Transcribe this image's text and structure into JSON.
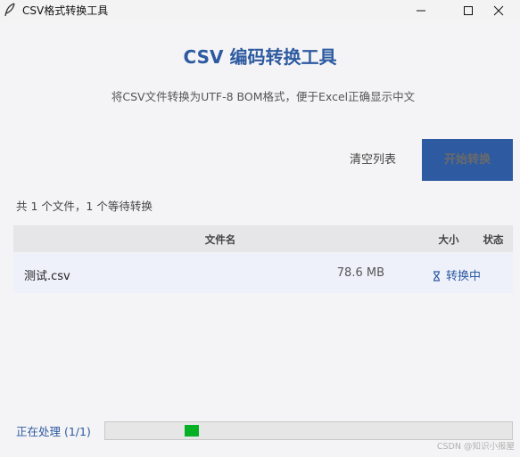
{
  "window": {
    "title": "CSV格式转换工具",
    "icon": "feather-icon"
  },
  "header": {
    "title": "CSV 编码转换工具",
    "subtitle": "将CSV文件转换为UTF-8 BOM格式，便于Excel正确显示中文"
  },
  "toolbar": {
    "clear_label": "清空列表",
    "start_label": "开始转换"
  },
  "summary": "共 1 个文件，1 个等待转换",
  "table": {
    "columns": [
      "文件名",
      "大小",
      "状态"
    ],
    "rows": [
      {
        "name": "测试.csv",
        "size": "78.6 MB",
        "status": "转换中",
        "status_icon": "hourglass-icon"
      }
    ]
  },
  "footer": {
    "status_text": "正在处理 (1/1)",
    "progress_mode": "indeterminate"
  },
  "watermark": "CSDN @知识小报屋",
  "colors": {
    "accent": "#2d5aa0",
    "progress": "#06b025",
    "background": "#f4f4f6",
    "header_row": "#e6e6e8",
    "row_highlight": "#eef1fa"
  }
}
